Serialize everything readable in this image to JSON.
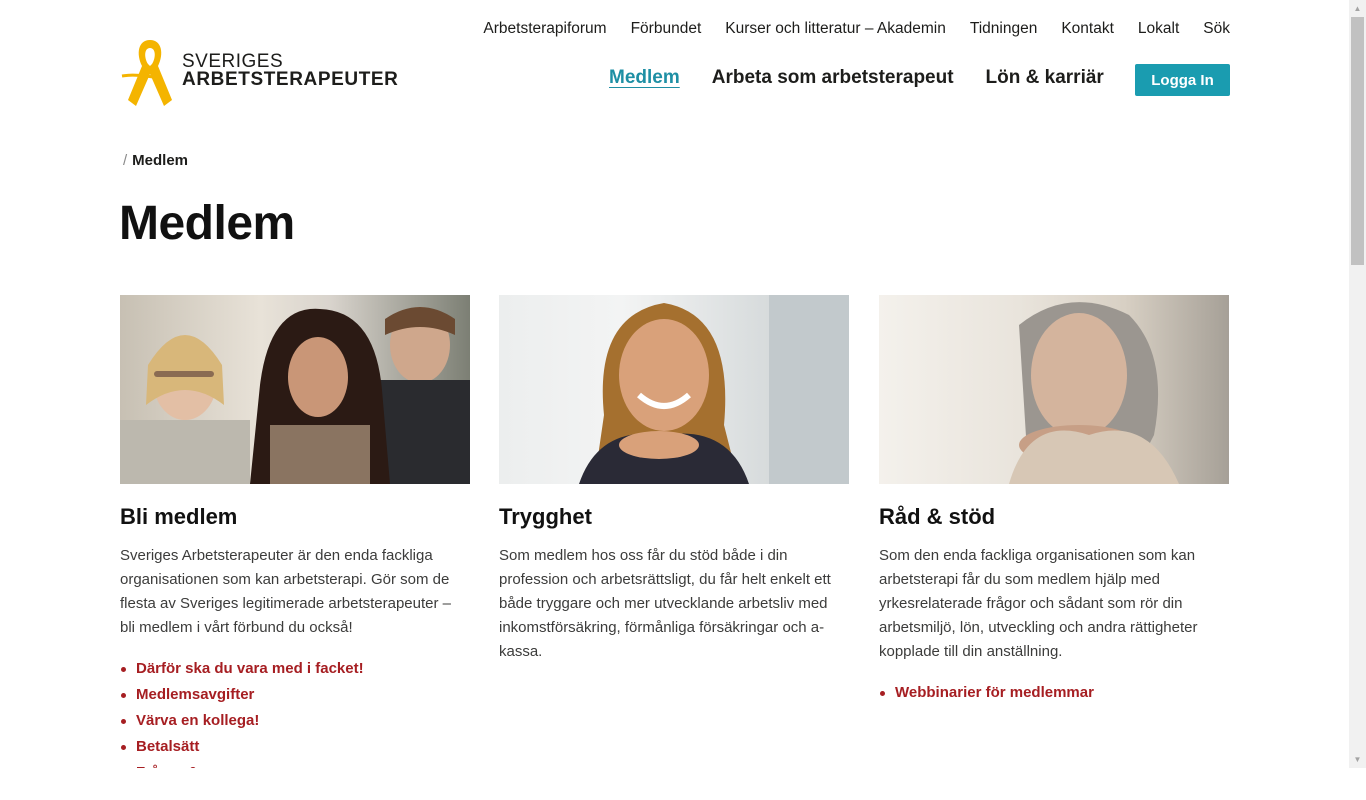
{
  "brand": {
    "line1": "SVERIGES",
    "line2": "ARBETSTERAPEUTER",
    "ribbon_color": "#f4b400"
  },
  "top_nav": [
    "Arbetsterapiforum",
    "Förbundet",
    "Kurser och litteratur – Akademin",
    "Tidningen",
    "Kontakt",
    "Lokalt",
    "Sök"
  ],
  "main_nav": {
    "items": [
      "Medlem",
      "Arbeta som arbetsterapeut",
      "Lön & karriär"
    ],
    "active": "Medlem",
    "login_label": "Logga In"
  },
  "breadcrumb": {
    "separator": "/",
    "current": "Medlem"
  },
  "page_title": "Medlem",
  "colors": {
    "accent": "#1a9cb0",
    "link": "#a61e22",
    "text": "#1d1d1b"
  },
  "cards": [
    {
      "title": "Bli medlem",
      "text": "Sveriges Arbetsterapeuter är den enda fackliga organisationen som kan arbetsterapi. Gör som de flesta av Sveriges legitimerade arbetsterapeuter – bli medlem i vårt förbund du också!",
      "links": [
        "Därför ska du vara med i facket!",
        "Medlemsavgifter",
        "Värva en kollega!",
        "Betalsätt",
        "Frågor & svar"
      ]
    },
    {
      "title": "Trygghet",
      "text": "Som medlem hos oss får du stöd både i din profession och arbetsrättsligt, du får helt enkelt ett både tryggare och mer utvecklande arbetsliv med inkomstförsäkring, förmånliga försäkringar och a-kassa.",
      "links": []
    },
    {
      "title": "Råd & stöd",
      "text": "Som den enda fackliga organisationen som kan arbetsterapi får du som medlem hjälp med yrkesrelaterade frågor och sådant som rör din arbetsmiljö, lön, utveckling och andra rättigheter kopplade till din anställning.",
      "links": [
        "Webbinarier för medlemmar"
      ]
    }
  ]
}
